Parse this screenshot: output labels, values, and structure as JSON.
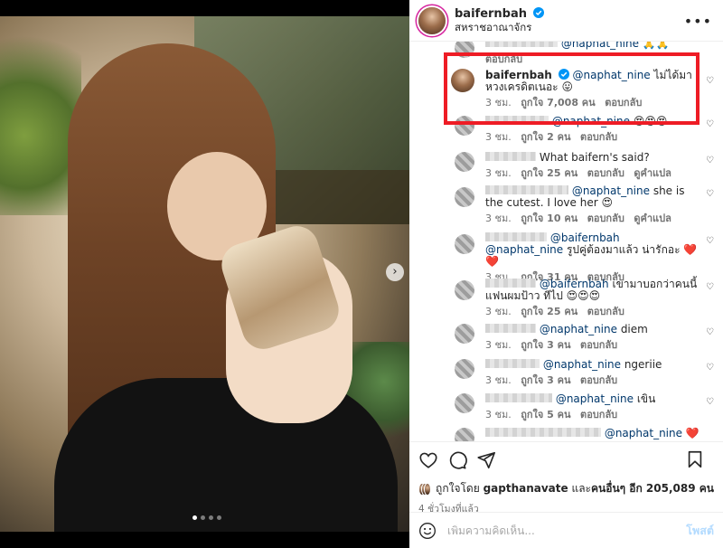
{
  "post": {
    "username": "baifernbah",
    "location": "สหราชอาณาจักร",
    "more": "•••",
    "carousel": {
      "index": 1,
      "total": 4,
      "next_glyph": "›"
    }
  },
  "comments": [
    {
      "user_blurred": true,
      "body_tail": "@naphat_nine 🙏🙏",
      "time": "",
      "likes": "",
      "reply": "ตอบกลับ",
      "translate": ""
    },
    {
      "username": "baifernbah",
      "verified": true,
      "mention": "@naphat_nine",
      "text": " ไม่ได้มาหวงเครดิตเนอะ 😛",
      "time": "3 ชม.",
      "likes": "ถูกใจ 7,008 คน",
      "reply": "ตอบกลับ",
      "translate": ""
    },
    {
      "user_blurred": true,
      "mention": "@naphat_nine",
      "text": " 😍😍😍",
      "time": "3 ชม.",
      "likes": "ถูกใจ 2 คน",
      "reply": "ตอบกลับ",
      "translate": ""
    },
    {
      "user_blurred": true,
      "text": "What baifern's said?",
      "time": "3 ชม.",
      "likes": "ถูกใจ 25 คน",
      "reply": "ตอบกลับ",
      "translate": "ดูคำแปล"
    },
    {
      "user_blurred": true,
      "mention": "@naphat_nine",
      "text": " she is the cutest. I love her 😍",
      "time": "3 ชม.",
      "likes": "ถูกใจ 10 คน",
      "reply": "ตอบกลับ",
      "translate": "ดูคำแปล"
    },
    {
      "user_blurred": true,
      "mention": "@baifernbah @naphat_nine",
      "text": " รูปคู่ต้องมาแล้ว น่ารักอะ ❤️❤️",
      "time": "3 ชม.",
      "likes": "ถูกใจ 31 คน",
      "reply": "ตอบกลับ",
      "translate": ""
    },
    {
      "user_blurred": true,
      "mention": "@baifernbah",
      "text": " เขามาบอกว่าคนนี้แฟนผมป้าว ทีไป 😍😍😍",
      "time": "3 ชม.",
      "likes": "ถูกใจ 25 คน",
      "reply": "ตอบกลับ",
      "translate": ""
    },
    {
      "user_blurred": true,
      "mention": "@naphat_nine",
      "text": " diem",
      "time": "3 ชม.",
      "likes": "ถูกใจ 3 คน",
      "reply": "ตอบกลับ",
      "translate": ""
    },
    {
      "user_blurred": true,
      "mention": "@naphat_nine",
      "text": " ngeriie",
      "time": "3 ชม.",
      "likes": "ถูกใจ 3 คน",
      "reply": "ตอบกลับ",
      "translate": ""
    },
    {
      "user_blurred": true,
      "mention": "@naphat_nine",
      "text": " เขิน",
      "time": "3 ชม.",
      "likes": "ถูกใจ 5 คน",
      "reply": "ตอบกลับ",
      "translate": ""
    },
    {
      "user_blurred": true,
      "mention": "@naphat_nine",
      "text": " ❤️",
      "time": "",
      "likes": "",
      "reply": "",
      "translate": ""
    }
  ],
  "likes_summary": {
    "prefix": "ถูกใจโดย ",
    "first_user": "gapthanavate",
    "middle": " และ",
    "others": "คนอื่นๆ อีก 205,089 คน"
  },
  "timestamp": "4 ชั่วโมงที่แล้ว",
  "add_comment": {
    "placeholder": "เพิ่มความคิดเห็น...",
    "post_label": "โพสต์"
  },
  "icons": {
    "verified": "verified-badge-icon",
    "like": "heart-icon",
    "comment": "comment-bubble-icon",
    "share": "paper-plane-icon",
    "save": "bookmark-icon",
    "emoji": "smiley-icon"
  },
  "colors": {
    "highlight_box": "#ee1c25",
    "mention": "#00376b",
    "verified": "#0095f6",
    "post_button": "#b3dbff"
  }
}
